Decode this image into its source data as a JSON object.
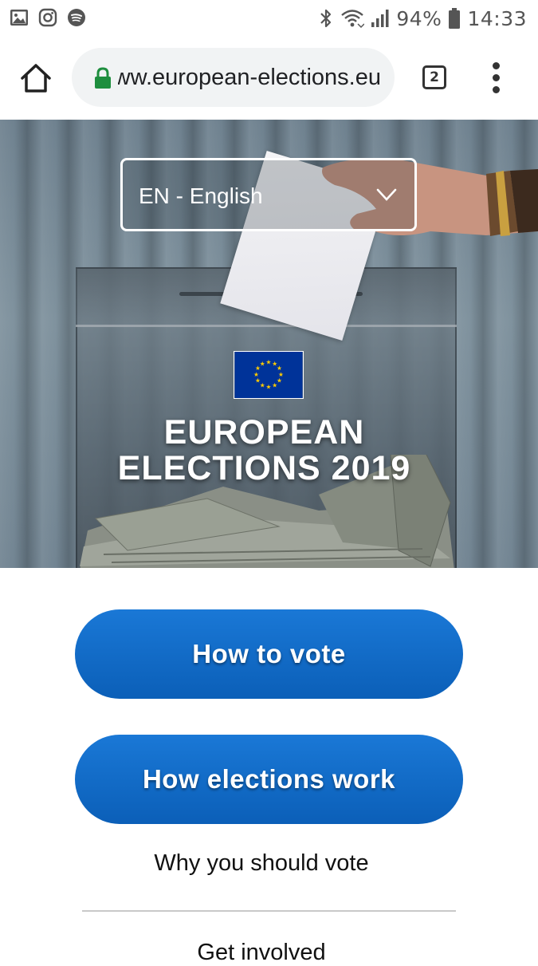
{
  "status_bar": {
    "left_icons": [
      "gallery-icon",
      "instagram-icon",
      "spotify-icon"
    ],
    "right_icons": [
      "bluetooth-icon",
      "wifi-icon",
      "signal-icon",
      "battery-icon"
    ],
    "battery": "94%",
    "time": "14:33"
  },
  "browser": {
    "url": "www.european-elections.eu",
    "tab_count": "2",
    "secure_color": "#1e8e3e"
  },
  "hero": {
    "language": "EN - English",
    "title_line1": "EUROPEAN",
    "title_line2": "ELECTIONS 2019",
    "flag_colors": {
      "blue": "#003399",
      "star": "#ffcc00"
    }
  },
  "main": {
    "button_vote": "How to vote",
    "button_work": "How elections work",
    "link_why": "Why you should vote",
    "link_get": "Get involved",
    "button_color": "#0b66c3"
  }
}
